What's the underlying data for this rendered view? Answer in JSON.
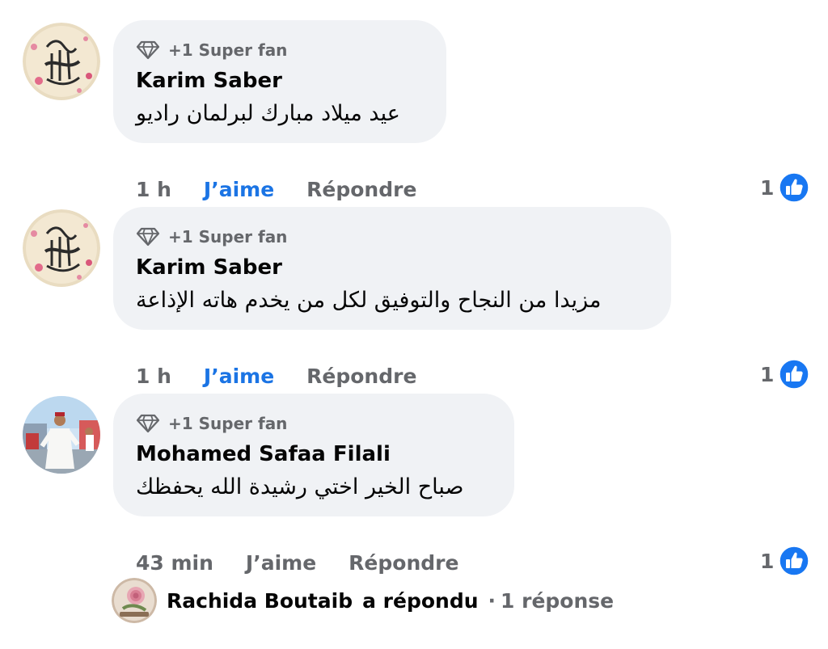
{
  "comments": [
    {
      "badge": "+1 Super fan",
      "author": "Karim Saber",
      "text": "عيد ميلاد مبارك لبرلمان راديو",
      "time": "1 h",
      "like_label": "J’aime",
      "reply_label": "Répondre",
      "reaction_count": "1"
    },
    {
      "badge": "+1 Super fan",
      "author": "Karim Saber",
      "text": "مزيدا من النجاح والتوفيق لكل من يخدم هاته الإذاعة",
      "time": "1 h",
      "like_label": "J’aime",
      "reply_label": "Répondre",
      "reaction_count": "1"
    },
    {
      "badge": "+1 Super fan",
      "author": "Mohamed Safaa Filali",
      "text": "صباح الخير اختي رشيدة الله يحفظك",
      "time": "43 min",
      "like_label": "J’aime",
      "reply_label": "Répondre",
      "reaction_count": "1"
    }
  ],
  "replies": {
    "name": "Rachida Boutaib",
    "verb": "a répondu",
    "separator": "·",
    "count": "1 réponse"
  },
  "colors": {
    "like_active": "#1b74e4",
    "secondary_text": "#65676b",
    "bubble_bg": "#f0f2f5",
    "reaction_blue": "#1877f2"
  },
  "icons": [
    "diamond-icon",
    "thumbs-up-reaction-icon"
  ]
}
